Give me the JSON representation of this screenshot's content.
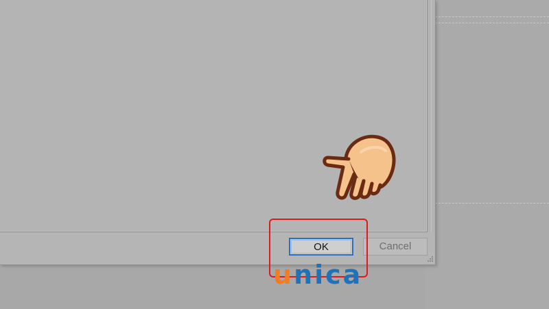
{
  "dialog": {
    "ok_label": "OK",
    "cancel_label": "Cancel"
  },
  "logo": {
    "first_letter": "u",
    "rest": "nica",
    "colors": {
      "first_letter": "#f47c20",
      "rest": "#1e73b8"
    }
  },
  "annotation": {
    "highlight_color": "#e0191b",
    "pointer_icon": "pointing-hand-icon"
  }
}
